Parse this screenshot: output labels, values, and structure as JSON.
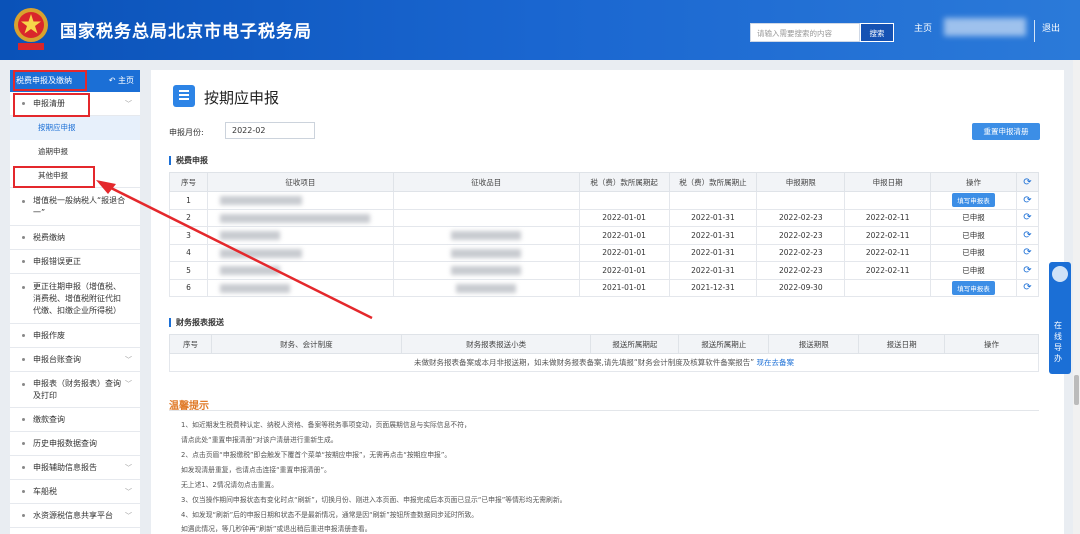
{
  "header": {
    "title": "国家税务总局北京市电子税务局",
    "search_placeholder": "请输入需要搜索的内容",
    "search_button": "搜索",
    "home": "主页",
    "logout": "退出"
  },
  "sidebar": {
    "section_label": "税费申报及缴纳",
    "home_label": "主页",
    "items": [
      {
        "label": "申报清册",
        "expandable": true
      },
      {
        "label": "按期应申报",
        "sub": true,
        "active": true
      },
      {
        "label": "逾期申报",
        "sub": true
      },
      {
        "label": "其他申报",
        "sub": true
      },
      {
        "label": "增值税一般纳税人“报退合一”"
      },
      {
        "label": "税费缴纳"
      },
      {
        "label": "申报错误更正"
      },
      {
        "label": "更正往期申报（增值税、消费税、增值税附征代扣代缴、扣缴企业所得税）"
      },
      {
        "label": "申报作废"
      },
      {
        "label": "申报台账查询",
        "expandable": true
      },
      {
        "label": "申报表（财务报表）查询及打印",
        "expandable": true
      },
      {
        "label": "缴款查询"
      },
      {
        "label": "历史申报数据查询"
      },
      {
        "label": "申报辅助信息报告",
        "expandable": true
      },
      {
        "label": "车船税",
        "expandable": true
      },
      {
        "label": "水资源税信息共享平台",
        "expandable": true
      }
    ]
  },
  "main": {
    "page_title": "按期应申报",
    "month_label": "申报月份:",
    "month_value": "2022-02",
    "reset_button": "重置申报清册",
    "tax_section": "税费申报",
    "tax_headers": [
      "序号",
      "征收项目",
      "征收品目",
      "税（费）款所属期起",
      "税（费）款所属期止",
      "申报期限",
      "申报日期",
      "操作"
    ],
    "tax_rows": [
      {
        "no": "1",
        "start": "",
        "end": "",
        "deadline": "",
        "date": "",
        "op": "填写申报表",
        "op_button": true
      },
      {
        "no": "2",
        "start": "2022-01-01",
        "end": "2022-01-31",
        "deadline": "2022-02-23",
        "date": "2022-02-11",
        "op": "已申报",
        "op_button": false
      },
      {
        "no": "3",
        "start": "2022-01-01",
        "end": "2022-01-31",
        "deadline": "2022-02-23",
        "date": "2022-02-11",
        "op": "已申报",
        "op_button": false
      },
      {
        "no": "4",
        "start": "2022-01-01",
        "end": "2022-01-31",
        "deadline": "2022-02-23",
        "date": "2022-02-11",
        "op": "已申报",
        "op_button": false
      },
      {
        "no": "5",
        "start": "2022-01-01",
        "end": "2022-01-31",
        "deadline": "2022-02-23",
        "date": "2022-02-11",
        "op": "已申报",
        "op_button": false
      },
      {
        "no": "6",
        "start": "2021-01-01",
        "end": "2021-12-31",
        "deadline": "2022-09-30",
        "date": "",
        "op": "填写申报表",
        "op_button": true
      }
    ],
    "finance_section": "财务报表报送",
    "finance_headers": [
      "序号",
      "财务、会计制度",
      "财务报表报送小类",
      "报送所属期起",
      "报送所属期止",
      "报送期限",
      "报送日期",
      "操作"
    ],
    "finance_notice": "未做财务报表备案或本月非报送期，如未做财务报表备案,请先填报“财务会计制度及核算软件备案报告”",
    "finance_link": "现在去备案"
  },
  "tips": {
    "title": "温馨提示",
    "lines": [
      "1、如近期发生税费种认定、纳税人资格、备案等税务事项变动，页面展期信息与实际信息不符，",
      "请点此处“重置申报清册”对该户清册进行重新生成。",
      "2、点击页眉“申报缴税”即会触发下覆首个菜单“按期应申报”，无需再点击“按期应申报”。",
      "如发现清册重复，也请点击连接“重置申报清册”。",
      "无上述1、2情况请勿点击重置。",
      "3、仅当操作期间申报状态有变化时点“刷新”，切换月份、刚进入本页面、申报完成后本页面已显示“已申报”等情形均无需刷新。",
      "4、如发现“刷新”后的申报日期和状态不是最新情况，通常是因“刷新”按钮所查数据同步延时所致。",
      "如遇此情况，等几秒钟再“刷新”或退出稍后重进申报清册查看。"
    ],
    "link_text": "重置申报清册"
  },
  "float_tool": {
    "label": "在线导办"
  }
}
